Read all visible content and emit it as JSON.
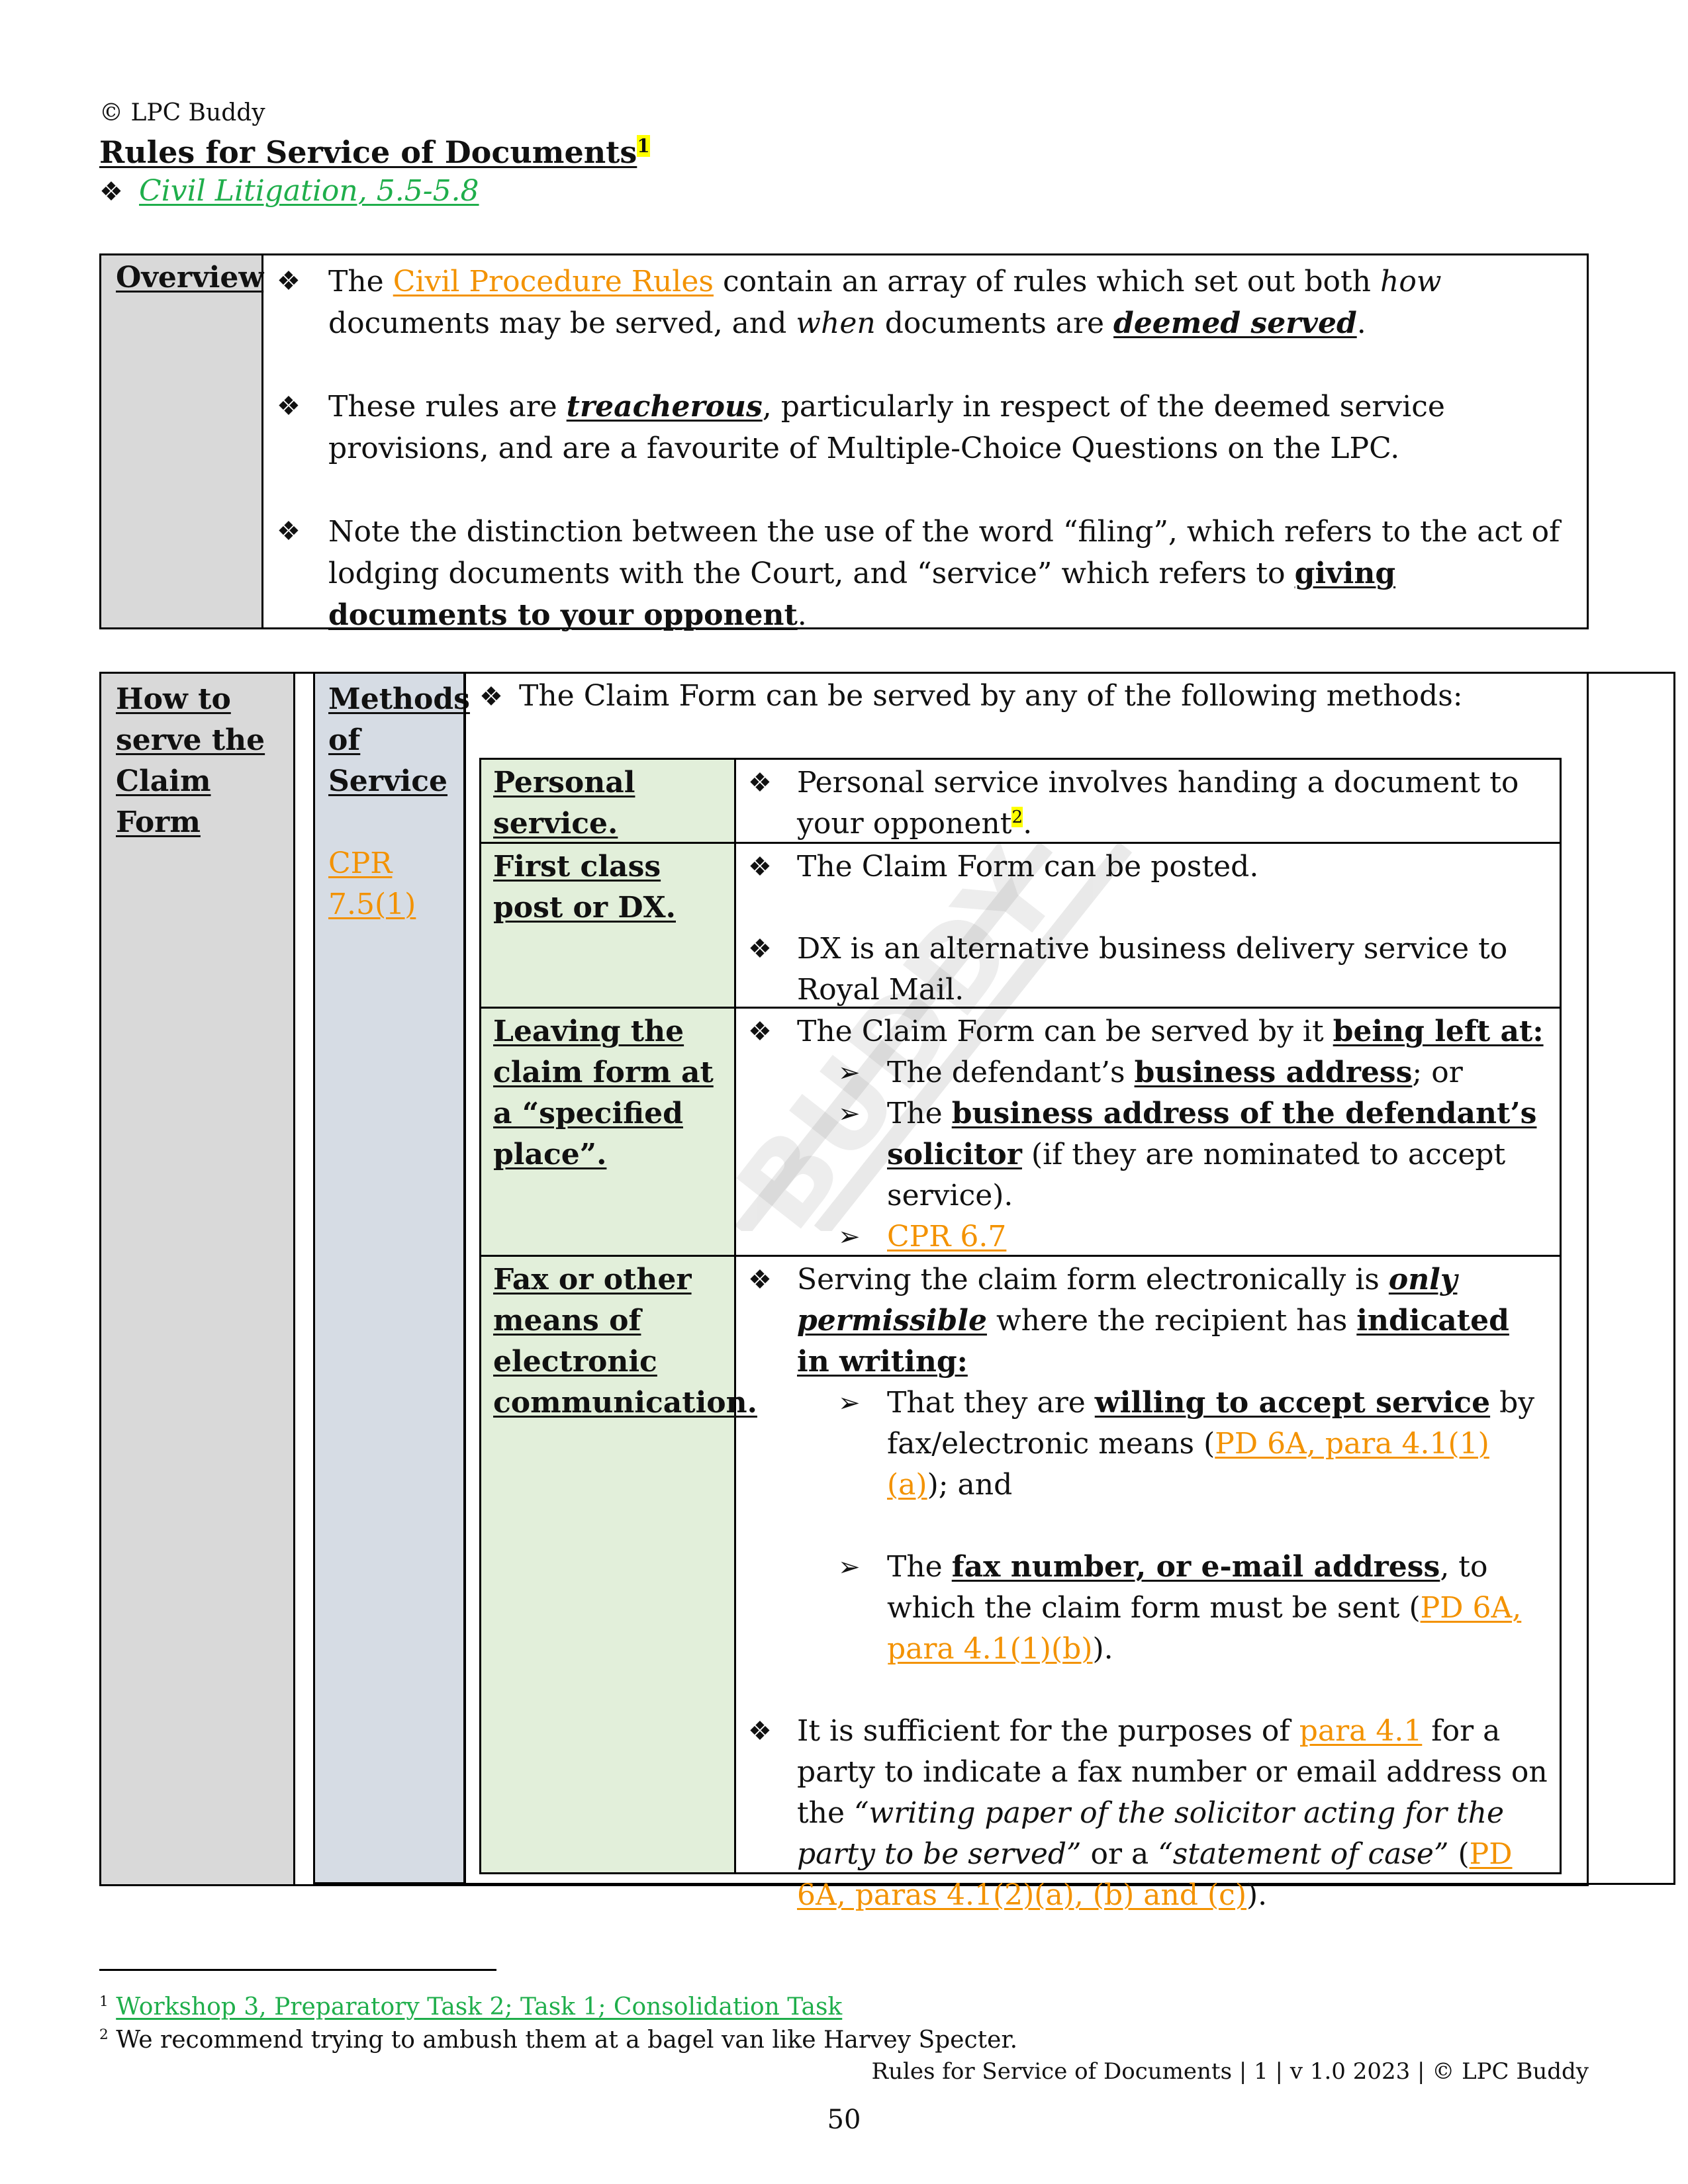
{
  "header": {
    "copyright": "© LPC Buddy",
    "title": "Rules for Service of Documents",
    "title_footnote_ref": "1",
    "reference_link": "Civil Litigation, 5.5-5.8"
  },
  "colors": {
    "green_link": "#1fae4b",
    "orange_link": "#f39200",
    "highlight": "#ffff00",
    "overview_label_bg": "#d9d9d9",
    "methods_label_bg": "#d6dce4",
    "method_row_bg": "#e2efda"
  },
  "overview": {
    "label": "Overview",
    "bullets": [
      {
        "p1": "The ",
        "link": "Civil Procedure Rules",
        "p2": " contain an array of rules which set out both ",
        "em1": "how",
        "p3": " documents may be served, and ",
        "em2": "when",
        "p4": " documents are ",
        "strong": "deemed served",
        "p5": "."
      },
      {
        "p1": "These rules are ",
        "strong": "treacherous",
        "p2": ", particularly in respect of the deemed service provisions, and are a favourite of Multiple-Choice Questions on the LPC."
      },
      {
        "p1": "Note the distinction between the use of the word “filing”, which refers to the act of lodging documents with the Court, and “service” which refers to ",
        "strong": "giving documents to your opponent",
        "p2": "."
      }
    ]
  },
  "claim_form": {
    "label": "How to serve the Claim Form",
    "methods_label": "Methods of Service",
    "methods_ref": "CPR 7.5(1)",
    "intro": "The Claim Form can be served by any of the following methods:",
    "methods": [
      {
        "name": "Personal service.",
        "text": "Personal service involves handing a document to your opponent",
        "footnote_ref": "2",
        "tail": "."
      },
      {
        "name": "First class post or DX.",
        "bullet1": "The Claim Form can be posted.",
        "bullet2": "DX is an alternative business delivery service to Royal Mail."
      },
      {
        "name": "Leaving the claim form at a “specified place”.",
        "lead": "The Claim Form can be served by it ",
        "lead_strong": "being left at:",
        "sub1_pre": "The defendant’s ",
        "sub1_strong": "business address",
        "sub1_post": "; or",
        "sub2_pre": "The ",
        "sub2_strong": "business address of the defendant’s solicitor",
        "sub2_post": " (if they are nominated to accept service).",
        "sub3_link": "CPR 6.7"
      },
      {
        "name": "Fax or other means of electronic communication.",
        "lead1": "Serving the claim form electronically is ",
        "lead_em": "only permissible",
        "lead2": " where the recipient has ",
        "lead_strong": "indicated in writing:",
        "sub1_pre": "That they are ",
        "sub1_strong": "willing to accept service",
        "sub1_mid": " by fax/electronic means (",
        "sub1_link": "PD 6A, para 4.1(1)(a)",
        "sub1_post": "); and",
        "sub2_pre": "The ",
        "sub2_strong": "fax number, or e-mail address",
        "sub2_mid": ", to which the claim form must be sent (",
        "sub2_link": "PD 6A, para 4.1(1)(b)",
        "sub2_post": ").",
        "b2_pre": "It is sufficient for the purposes of ",
        "b2_link1": "para 4.1",
        "b2_mid1": " for a party to indicate a fax number or email address on the ",
        "b2_em1": "“writing paper of the solicitor acting for the party to be served”",
        "b2_mid2": " or a ",
        "b2_em2": "“statement of case”",
        "b2_mid3": " (",
        "b2_link2": "PD 6A, paras 4.1(2)(a), (b) and (c)",
        "b2_post": ")."
      }
    ]
  },
  "watermark": {
    "text": "BUDDY",
    "icon": "graduation-cap-icon"
  },
  "footnotes": [
    {
      "ref": "1",
      "text": "Workshop 3, Preparatory Task 2; Task 1; Consolidation Task"
    },
    {
      "ref": "2",
      "text": "We recommend trying to ambush them at a bagel van like Harvey Specter."
    }
  ],
  "footer": {
    "running": "Rules for Service of Documents | 1 | v 1.0 2023 | © LPC Buddy",
    "page_number": "50"
  },
  "icons": {
    "bullet": "❖",
    "arrow": "➢"
  }
}
